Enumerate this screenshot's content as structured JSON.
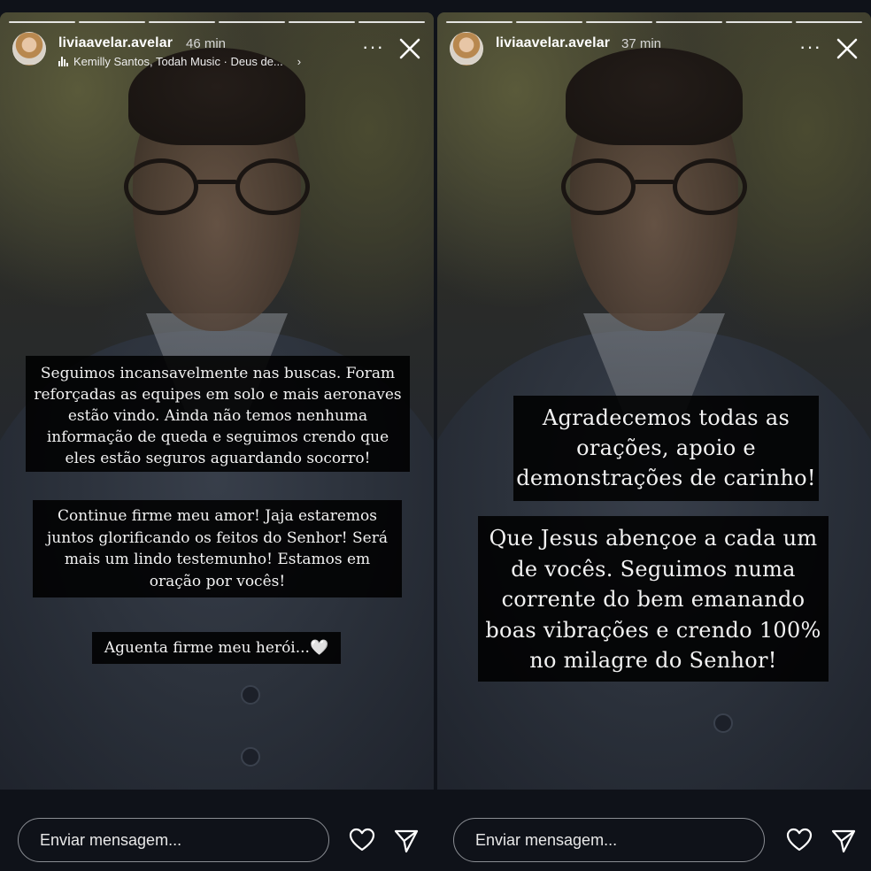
{
  "stories": [
    {
      "username": "liviaavelar.avelar",
      "time": "46 min",
      "music": "Kemilly Santos, Todah Music · Deus de...",
      "progress_segments": 6,
      "captions": [
        "Seguimos incansavelmente nas buscas. Foram\nreforçadas as equipes em solo e mais aeronaves\nestão vindo. Ainda não temos nenhuma\ninformação de queda e seguimos crendo que\neles estão seguros aguardando socorro!",
        "Continue firme meu amor! Jaja estaremos\njuntos glorificando os feitos do Senhor! Será\nmais um lindo testemunho! Estamos em\noração por vocês!",
        "Aguenta firme meu herói...🤍"
      ],
      "message_placeholder": "Enviar mensagem..."
    },
    {
      "username": "liviaavelar.avelar",
      "time": "37 min",
      "progress_segments": 6,
      "captions": [
        "Agradecemos todas as\norações, apoio e\ndemonstrações de carinho!",
        "Que Jesus abençoe a cada um\nde vocês. Seguimos numa\ncorrente do bem emanando\nboas vibrações e crendo 100%\nno milagre do Senhor!"
      ],
      "message_placeholder": "Enviar mensagem..."
    }
  ],
  "icons": {
    "more": "more-options-icon",
    "close": "close-icon",
    "like": "heart-icon",
    "send": "send-icon",
    "music": "music-bars-icon",
    "chevron": "chevron-right-icon"
  },
  "colors": {
    "background": "#0f1219",
    "caption_bg": "#000000",
    "text": "#ffffff"
  }
}
